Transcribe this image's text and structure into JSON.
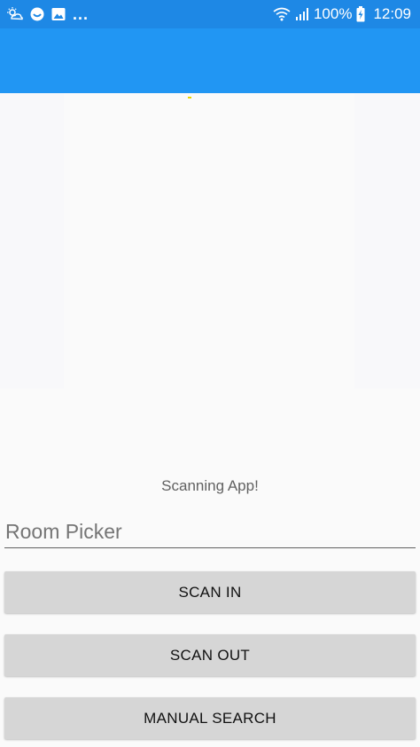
{
  "status_bar": {
    "icons_left": [
      "weather-icon",
      "app-icon",
      "image-icon"
    ],
    "overflow": "...",
    "battery_percent": "100%",
    "time": "12:09"
  },
  "colors": {
    "status_bar": "#1e88e5",
    "toolbar": "#2196f3",
    "background": "#fafafa",
    "button": "#d6d6d6"
  },
  "main": {
    "title": "Scanning App!",
    "room_picker_placeholder": "Room Picker",
    "buttons": {
      "scan_in": "SCAN IN",
      "scan_out": "SCAN OUT",
      "manual_search": "MANUAL SEARCH"
    }
  }
}
